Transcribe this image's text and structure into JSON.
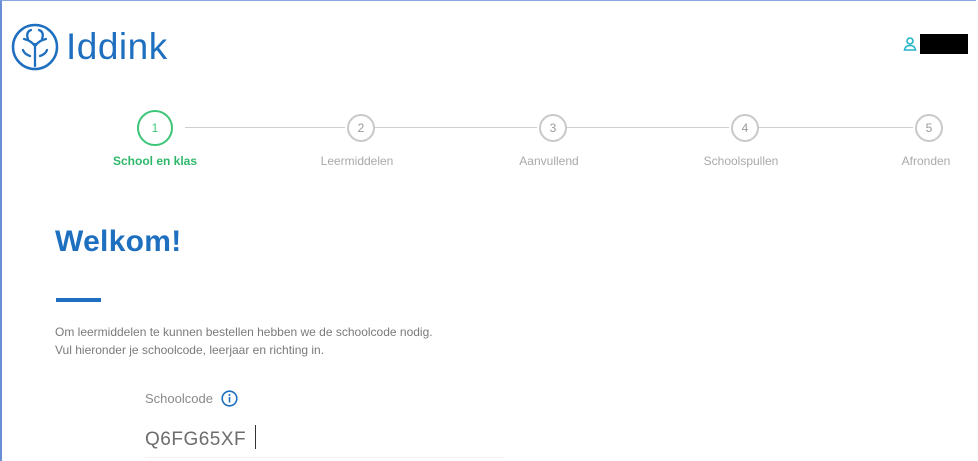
{
  "brand": {
    "name": "Iddink",
    "color": "#1e6fbf",
    "icon": "iddink-logo-icon"
  },
  "account": {
    "icon": "user-icon",
    "name": ""
  },
  "steps": [
    {
      "number": "1",
      "label": "School en klas",
      "active": true
    },
    {
      "number": "2",
      "label": "Leermiddelen",
      "active": false
    },
    {
      "number": "3",
      "label": "Aanvullend",
      "active": false
    },
    {
      "number": "4",
      "label": "Schoolspullen",
      "active": false
    },
    {
      "number": "5",
      "label": "Afronden",
      "active": false
    }
  ],
  "colors": {
    "active_step": "#3cc678",
    "inactive_step": "#c9c9c9",
    "heading": "#1e6fbf"
  },
  "main": {
    "title": "Welkom!",
    "intro_line1": "Om leermiddelen te kunnen bestellen hebben we de schoolcode nodig.",
    "intro_line2": "Vul hieronder je schoolcode, leerjaar en richting in.",
    "schoolcode_label": "Schoolcode",
    "schoolcode_value": "Q6FG65XF",
    "info_icon": "info-icon"
  }
}
